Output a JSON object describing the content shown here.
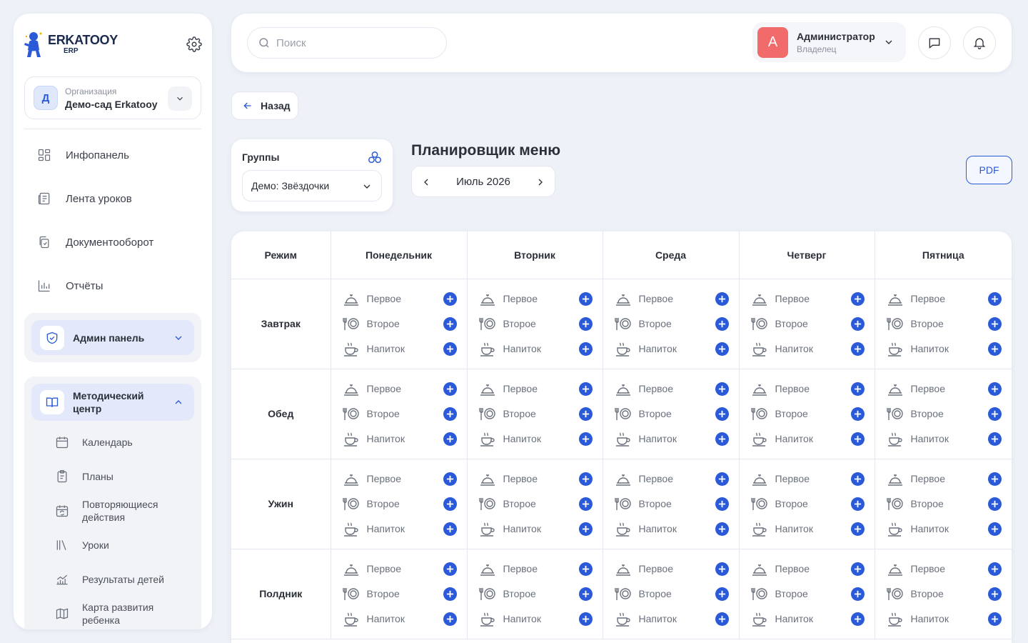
{
  "brand": {
    "name": "ERKATOOY",
    "sub": "ERP"
  },
  "org": {
    "avatar": "Д",
    "label": "Организация",
    "value": "Демо-сад Erkatooy"
  },
  "nav": [
    {
      "label": "Инфопанель",
      "icon": "dashboard-icon"
    },
    {
      "label": "Лента уроков",
      "icon": "news-feed-icon"
    },
    {
      "label": "Документооборот",
      "icon": "documents-icon"
    },
    {
      "label": "Отчёты",
      "icon": "reports-icon"
    }
  ],
  "admin_panel": {
    "label": "Админ панель",
    "icon": "shield-icon",
    "expanded": false
  },
  "methodical": {
    "label": "Методический центр",
    "icon": "book-icon",
    "expanded": true,
    "items": [
      {
        "label": "Календарь",
        "icon": "calendar-icon"
      },
      {
        "label": "Планы",
        "icon": "clipboard-icon"
      },
      {
        "label": "Повторяющиеся действия",
        "icon": "recurring-calendar-icon"
      },
      {
        "label": "Уроки",
        "icon": "library-icon"
      },
      {
        "label": "Результаты детей",
        "icon": "growth-chart-icon"
      },
      {
        "label": "Карта развития ребенка",
        "icon": "map-icon"
      }
    ]
  },
  "topbar": {
    "search_placeholder": "Поиск",
    "user": {
      "avatar": "А",
      "name": "Администратор",
      "role": "Владелец"
    }
  },
  "back_label": "Назад",
  "groups": {
    "label": "Группы",
    "selected": "Демо: Звёздочки"
  },
  "page_title": "Планировщик меню",
  "month": "Июль 2026",
  "pdf_label": "PDF",
  "table": {
    "mode_header": "Режим",
    "days": [
      "Понедельник",
      "Вторник",
      "Среда",
      "Четверг",
      "Пятница"
    ],
    "meals": [
      "Завтрак",
      "Обед",
      "Ужин",
      "Полдник"
    ],
    "dishes": [
      {
        "label": "Первое",
        "icon": "cloche-icon"
      },
      {
        "label": "Второе",
        "icon": "plate-cutlery-icon"
      },
      {
        "label": "Напиток",
        "icon": "hot-drink-icon"
      }
    ]
  },
  "colors": {
    "accent": "#2a5ad7",
    "avatar_user": "#f26b6b",
    "background": "#eef1f8"
  }
}
